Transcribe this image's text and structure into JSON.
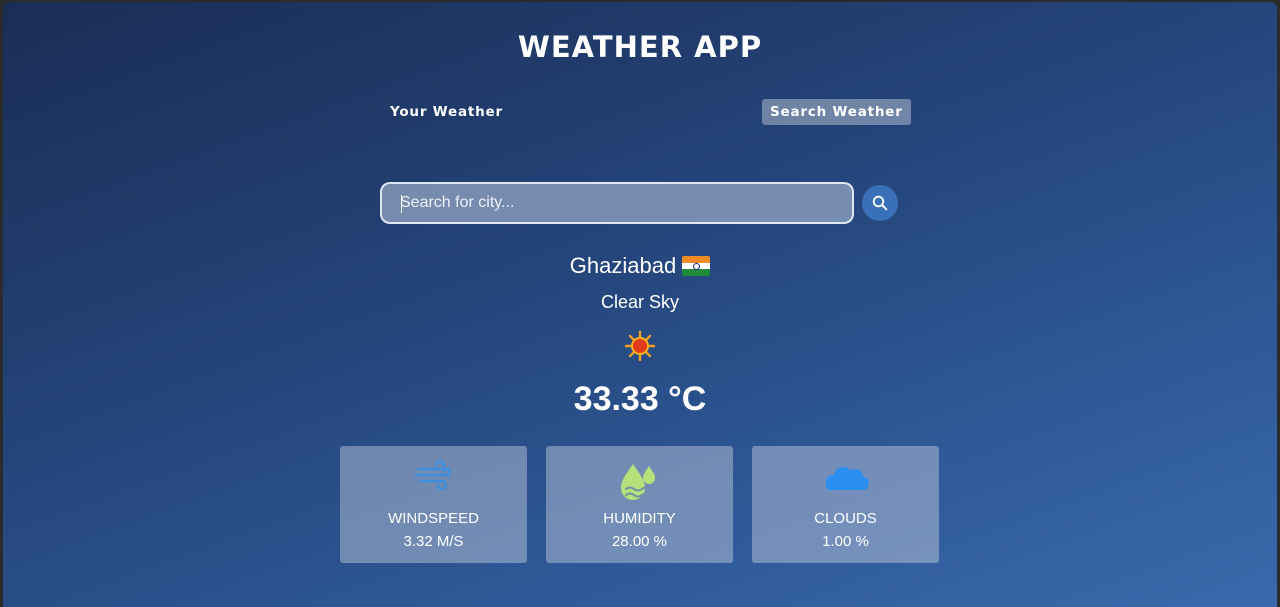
{
  "app": {
    "title": "WEATHER APP"
  },
  "tabs": [
    {
      "label": "Your Weather",
      "active": false
    },
    {
      "label": "Search Weather",
      "active": true
    }
  ],
  "search": {
    "placeholder": "Search for city...",
    "value": "",
    "icon": "search-icon"
  },
  "weather": {
    "city": "Ghaziabad",
    "country_flag": "india-flag-icon",
    "description": "Clear Sky",
    "icon": "sun-icon",
    "temperature": "33.33 °C"
  },
  "stats": [
    {
      "label": "WINDSPEED",
      "value": "3.32 M/S",
      "icon": "wind-icon",
      "color": "#3d8fe0"
    },
    {
      "label": "HUMIDITY",
      "value": "28.00 %",
      "icon": "humidity-drops-icon",
      "color": "#b6e07a"
    },
    {
      "label": "CLOUDS",
      "value": "1.00 %",
      "icon": "cloud-icon",
      "color": "#2a8ff0"
    }
  ],
  "colors": {
    "background_top": "#1a2d55",
    "background_bottom": "#3a6aac",
    "search_button": "#3a70b8"
  }
}
